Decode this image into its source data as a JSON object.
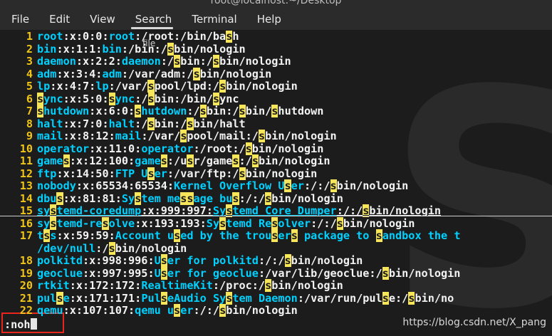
{
  "window": {
    "title": "root@localhost:~/Desktop"
  },
  "menu": {
    "items": [
      {
        "id": "file",
        "label": "File",
        "active": false
      },
      {
        "id": "edit",
        "label": "Edit",
        "active": false
      },
      {
        "id": "view",
        "label": "View",
        "active": false
      },
      {
        "id": "search",
        "label": "Search",
        "active": true
      },
      {
        "id": "terminal",
        "label": "Terminal",
        "active": false
      },
      {
        "id": "help",
        "label": "Help",
        "active": false
      }
    ]
  },
  "tooltip": "file",
  "terminal": {
    "lines": [
      {
        "n": "1",
        "segs": [
          [
            "f",
            "root"
          ],
          [
            "c",
            ":x:0:0:"
          ],
          [
            "f",
            "root"
          ],
          [
            "c",
            ":/root:/bin/ba"
          ],
          [
            "h",
            "s"
          ],
          [
            "c",
            "h"
          ]
        ]
      },
      {
        "n": "2",
        "segs": [
          [
            "f",
            "bin"
          ],
          [
            "c",
            ":x:1:1:"
          ],
          [
            "f",
            "bin"
          ],
          [
            "c",
            ":/bin:/"
          ],
          [
            "h",
            "s"
          ],
          [
            "c",
            "bin/nologin"
          ]
        ]
      },
      {
        "n": "3",
        "segs": [
          [
            "f",
            "daemon"
          ],
          [
            "c",
            ":x:2:2:"
          ],
          [
            "f",
            "daemon"
          ],
          [
            "c",
            ":/"
          ],
          [
            "h",
            "s"
          ],
          [
            "c",
            "bin:/"
          ],
          [
            "h",
            "s"
          ],
          [
            "c",
            "bin/nologin"
          ]
        ]
      },
      {
        "n": "4",
        "segs": [
          [
            "f",
            "adm"
          ],
          [
            "c",
            ":x:3:4:"
          ],
          [
            "f",
            "adm"
          ],
          [
            "c",
            ":/var/adm:/"
          ],
          [
            "h",
            "s"
          ],
          [
            "c",
            "bin/nologin"
          ]
        ]
      },
      {
        "n": "5",
        "segs": [
          [
            "f",
            "lp"
          ],
          [
            "c",
            ":x:4:7:"
          ],
          [
            "f",
            "lp"
          ],
          [
            "c",
            ":/var/"
          ],
          [
            "h",
            "s"
          ],
          [
            "c",
            "pool/lpd:/"
          ],
          [
            "h",
            "s"
          ],
          [
            "c",
            "bin/nologin"
          ]
        ]
      },
      {
        "n": "6",
        "segs": [
          [
            "h",
            "s"
          ],
          [
            "f",
            "ync"
          ],
          [
            "c",
            ":x:5:0:"
          ],
          [
            "h",
            "s"
          ],
          [
            "f",
            "ync"
          ],
          [
            "c",
            ":/"
          ],
          [
            "h",
            "s"
          ],
          [
            "c",
            "bin:/bin/"
          ],
          [
            "h",
            "s"
          ],
          [
            "c",
            "ync"
          ]
        ]
      },
      {
        "n": "7",
        "segs": [
          [
            "h",
            "s"
          ],
          [
            "f",
            "hutdown"
          ],
          [
            "c",
            ":x:6:0:"
          ],
          [
            "h",
            "s"
          ],
          [
            "f",
            "hutdown"
          ],
          [
            "c",
            ":/"
          ],
          [
            "h",
            "s"
          ],
          [
            "c",
            "bin:/"
          ],
          [
            "h",
            "s"
          ],
          [
            "c",
            "bin/"
          ],
          [
            "h",
            "s"
          ],
          [
            "c",
            "hutdown"
          ]
        ]
      },
      {
        "n": "8",
        "segs": [
          [
            "f",
            "halt"
          ],
          [
            "c",
            ":x:7:0:"
          ],
          [
            "f",
            "halt"
          ],
          [
            "c",
            ":/"
          ],
          [
            "h",
            "s"
          ],
          [
            "c",
            "bin:/"
          ],
          [
            "h",
            "s"
          ],
          [
            "c",
            "bin/halt"
          ]
        ]
      },
      {
        "n": "9",
        "segs": [
          [
            "f",
            "mail"
          ],
          [
            "c",
            ":x:8:12:"
          ],
          [
            "f",
            "mail"
          ],
          [
            "c",
            ":/var/"
          ],
          [
            "h",
            "s"
          ],
          [
            "c",
            "pool/mail:/"
          ],
          [
            "h",
            "s"
          ],
          [
            "c",
            "bin/nologin"
          ]
        ]
      },
      {
        "n": "10",
        "segs": [
          [
            "f",
            "operator"
          ],
          [
            "c",
            ":x:11:0:"
          ],
          [
            "f",
            "operator"
          ],
          [
            "c",
            ":/root:/"
          ],
          [
            "h",
            "s"
          ],
          [
            "c",
            "bin/nologin"
          ]
        ]
      },
      {
        "n": "11",
        "segs": [
          [
            "f",
            "game"
          ],
          [
            "h",
            "s"
          ],
          [
            "c",
            ":x:12:100:"
          ],
          [
            "f",
            "game"
          ],
          [
            "h",
            "s"
          ],
          [
            "c",
            ":/u"
          ],
          [
            "h",
            "s"
          ],
          [
            "c",
            "r/game"
          ],
          [
            "h",
            "s"
          ],
          [
            "c",
            ":/"
          ],
          [
            "h",
            "s"
          ],
          [
            "c",
            "bin/nologin"
          ]
        ]
      },
      {
        "n": "12",
        "segs": [
          [
            "f",
            "ftp"
          ],
          [
            "c",
            ":x:14:50:"
          ],
          [
            "f",
            "FTP U"
          ],
          [
            "h",
            "s"
          ],
          [
            "f",
            "er"
          ],
          [
            "c",
            ":/var/ftp:/"
          ],
          [
            "h",
            "s"
          ],
          [
            "c",
            "bin/nologin"
          ]
        ]
      },
      {
        "n": "13",
        "segs": [
          [
            "f",
            "nobody"
          ],
          [
            "c",
            ":x:65534:65534:"
          ],
          [
            "f",
            "Kernel Overflow U"
          ],
          [
            "h",
            "s"
          ],
          [
            "f",
            "er"
          ],
          [
            "c",
            ":/:/"
          ],
          [
            "h",
            "s"
          ],
          [
            "c",
            "bin/nologin"
          ]
        ]
      },
      {
        "n": "14",
        "segs": [
          [
            "f",
            "dbu"
          ],
          [
            "h",
            "s"
          ],
          [
            "c",
            ":x:81:81:"
          ],
          [
            "f",
            "Sy"
          ],
          [
            "h",
            "s"
          ],
          [
            "f",
            "tem me"
          ],
          [
            "h",
            "s"
          ],
          [
            "h",
            "s"
          ],
          [
            "f",
            "age bu"
          ],
          [
            "h",
            "s"
          ],
          [
            "c",
            ":/:/"
          ],
          [
            "h",
            "s"
          ],
          [
            "c",
            "bin/nologin"
          ]
        ]
      },
      {
        "n": "15",
        "under": true,
        "segs": [
          [
            "f",
            "sy"
          ],
          [
            "h",
            "s"
          ],
          [
            "f",
            "temd-coredump"
          ],
          [
            "c",
            ":x:999:997:"
          ],
          [
            "f",
            "Sy"
          ],
          [
            "h",
            "s"
          ],
          [
            "f",
            "temd Core Dumper"
          ],
          [
            "c",
            ":/:/"
          ],
          [
            "h",
            "s"
          ],
          [
            "c",
            "bin/nologin"
          ]
        ]
      },
      {
        "n": "16",
        "segs": [
          [
            "f",
            "sy"
          ],
          [
            "h",
            "s"
          ],
          [
            "f",
            "temd-re"
          ],
          [
            "h",
            "s"
          ],
          [
            "f",
            "olve"
          ],
          [
            "c",
            ":x:193:193:"
          ],
          [
            "f",
            "Sy"
          ],
          [
            "h",
            "s"
          ],
          [
            "f",
            "temd Re"
          ],
          [
            "h",
            "s"
          ],
          [
            "f",
            "olver"
          ],
          [
            "c",
            ":/:/"
          ],
          [
            "h",
            "s"
          ],
          [
            "c",
            "bin/nologin"
          ]
        ]
      },
      {
        "n": "17",
        "segs": [
          [
            "f",
            "t"
          ],
          [
            "h",
            "s"
          ],
          [
            "f",
            "s"
          ],
          [
            "c",
            ":x:59:59:"
          ],
          [
            "f",
            "Account u"
          ],
          [
            "h",
            "s"
          ],
          [
            "f",
            "ed by the trou"
          ],
          [
            "h",
            "s"
          ],
          [
            "f",
            "er"
          ],
          [
            "h",
            "s"
          ],
          [
            "f",
            " package to "
          ],
          [
            "h",
            "s"
          ],
          [
            "f",
            "andbox the t"
          ]
        ]
      },
      {
        "n": "",
        "segs": [
          [
            "f",
            "/dev/null"
          ],
          [
            "c",
            ":/"
          ],
          [
            "h",
            "s"
          ],
          [
            "c",
            "bin/nologin"
          ]
        ]
      },
      {
        "n": "18",
        "segs": [
          [
            "f",
            "polkitd"
          ],
          [
            "c",
            ":x:998:996:"
          ],
          [
            "f",
            "U"
          ],
          [
            "h",
            "s"
          ],
          [
            "f",
            "er for polkitd"
          ],
          [
            "c",
            ":/:/"
          ],
          [
            "h",
            "s"
          ],
          [
            "c",
            "bin/nologin"
          ]
        ]
      },
      {
        "n": "19",
        "segs": [
          [
            "f",
            "geoclue"
          ],
          [
            "c",
            ":x:997:995:"
          ],
          [
            "f",
            "U"
          ],
          [
            "h",
            "s"
          ],
          [
            "f",
            "er for geoclue"
          ],
          [
            "c",
            ":/var/lib/geoclue:/"
          ],
          [
            "h",
            "s"
          ],
          [
            "c",
            "bin/nologin"
          ]
        ]
      },
      {
        "n": "20",
        "segs": [
          [
            "f",
            "rtkit"
          ],
          [
            "c",
            ":x:172:172:"
          ],
          [
            "f",
            "RealtimeKit"
          ],
          [
            "c",
            ":/proc:/"
          ],
          [
            "h",
            "s"
          ],
          [
            "c",
            "bin/nologin"
          ]
        ]
      },
      {
        "n": "21",
        "segs": [
          [
            "f",
            "pul"
          ],
          [
            "h",
            "s"
          ],
          [
            "f",
            "e"
          ],
          [
            "c",
            ":x:171:171:"
          ],
          [
            "f",
            "Pul"
          ],
          [
            "h",
            "s"
          ],
          [
            "f",
            "eAudio Sy"
          ],
          [
            "h",
            "s"
          ],
          [
            "f",
            "tem Daemon"
          ],
          [
            "c",
            ":/var/run/pul"
          ],
          [
            "h",
            "s"
          ],
          [
            "c",
            "e:/"
          ],
          [
            "h",
            "s"
          ],
          [
            "c",
            "bin/no"
          ]
        ]
      },
      {
        "n": "22",
        "segs": [
          [
            "f",
            "qemu"
          ],
          [
            "c",
            ":x:107:107:"
          ],
          [
            "f",
            "qemu u"
          ],
          [
            "h",
            "s"
          ],
          [
            "f",
            "er"
          ],
          [
            "c",
            ":/:/"
          ],
          [
            "h",
            "s"
          ],
          [
            "c",
            "bin/nologin"
          ]
        ]
      }
    ]
  },
  "command": {
    "text": ":noh"
  },
  "credit": "https://blog.csdn.net/X_pang"
}
